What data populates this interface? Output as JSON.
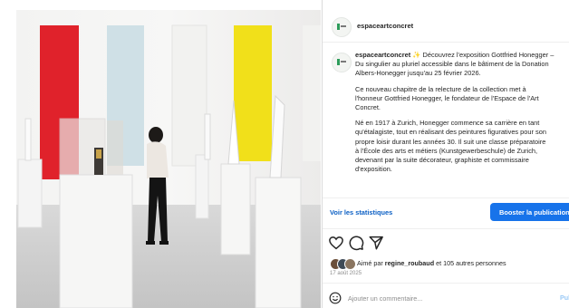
{
  "post": {
    "handle": "espaceartconcret",
    "caption": {
      "handle": "espaceartconcret",
      "emoji": "✨",
      "line1": " Découvrez l'exposition Gottfried Honegger –",
      "line2": "Du singulier au pluriel accessible dans le bâtiment de la Donation",
      "line3": "Albers-Honegger jusqu'au 25 février 2026.",
      "para2_line1": "Ce nouveau chapitre de la relecture de la collection met à",
      "para2_line2": "l'honneur Gottfried Honegger, le fondateur de l'Espace de l'Art",
      "para2_line3": "Concret.",
      "para3_line1": "Né en 1917 à Zurich, Honegger commence sa carrière en tant",
      "para3_line2": "qu'étalagiste, tout en réalisant des peintures figuratives pour son",
      "para3_line3": "propre loisir durant les années 30. Il suit une classe préparatoire",
      "para3_line4": "à l'École des arts et métiers (Kunstgewerbeschule) de Zurich,",
      "para3_line5": "devenant par la suite décorateur, graphiste et commissaire",
      "para3_line6": "d'exposition."
    },
    "stats_link": "Voir les statistiques",
    "boost_button": "Booster la publication",
    "likes": {
      "prefix": "Aimé par ",
      "user": "regine_roubaud",
      "suffix": " et 105 autres personnes"
    },
    "date": "17 août 2025",
    "comment": {
      "placeholder": "Ajouter un commentaire...",
      "publish": "Publier"
    }
  },
  "icons": {
    "like": "heart-icon",
    "comment": "comment-icon",
    "share": "share-icon",
    "emoji": "emoji-icon"
  },
  "colors": {
    "link": "#0b5fc4",
    "button": "#1773ea",
    "publish": "#9ac9f6",
    "secondary_text": "#8e8e8e",
    "artwork_red": "#e0222b",
    "artwork_light_blue": "#cfe0e6",
    "artwork_yellow": "#f1e01a"
  }
}
